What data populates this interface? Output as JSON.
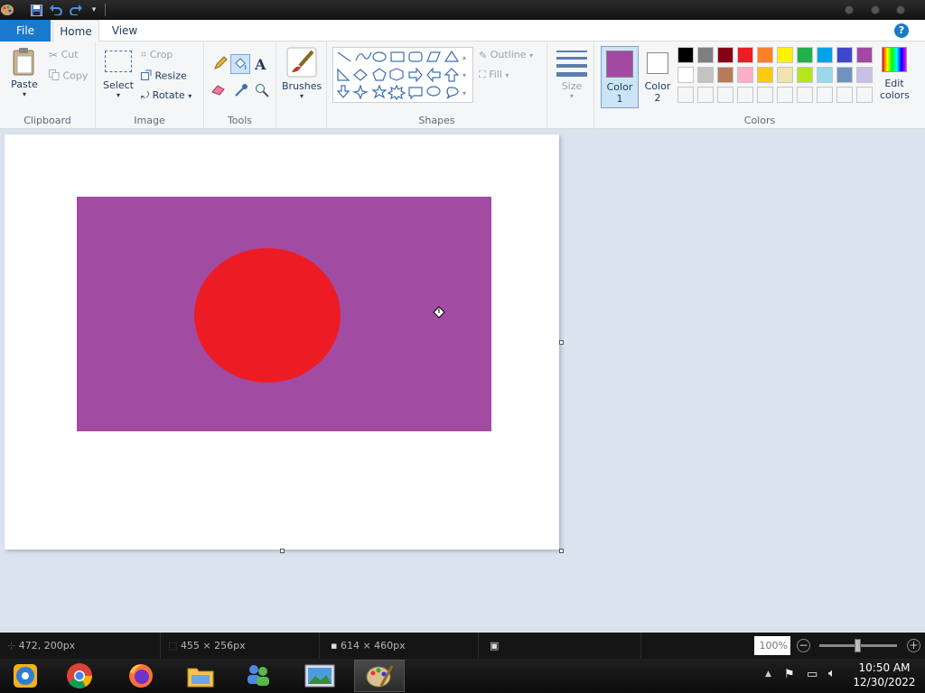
{
  "titlebar": {
    "quick_access": [
      "paint-app-icon",
      "save-icon",
      "undo-icon",
      "redo-icon",
      "customize-icon"
    ]
  },
  "tabs": {
    "file": "File",
    "home": "Home",
    "view": "View"
  },
  "ribbon": {
    "clipboard": {
      "label": "Clipboard",
      "paste": "Paste",
      "cut": "Cut",
      "copy": "Copy"
    },
    "image": {
      "label": "Image",
      "select": "Select",
      "crop": "Crop",
      "resize": "Resize",
      "rotate": "Rotate"
    },
    "tools": {
      "label": "Tools"
    },
    "brushes": {
      "label": "Brushes"
    },
    "shapes": {
      "label": "Shapes",
      "outline": "Outline",
      "fill": "Fill"
    },
    "size": {
      "label": "Size"
    },
    "colors": {
      "label": "Colors",
      "color1_label": "Color",
      "color1_num": "1",
      "color2_label": "Color",
      "color2_num": "2",
      "color1_value": "#a349a4",
      "color2_value": "#ffffff",
      "edit_label": "Edit",
      "edit_label2": "colors",
      "palette_row1": [
        "#000000",
        "#7f7f7f",
        "#880015",
        "#ed1c24",
        "#ff7f27",
        "#fff200",
        "#22b14c",
        "#00a2e8",
        "#3f48cc",
        "#a349a4"
      ],
      "palette_row2": [
        "#ffffff",
        "#c3c3c3",
        "#b97a57",
        "#ffaec9",
        "#ffc90e",
        "#efe4b0",
        "#b5e61d",
        "#99d9ea",
        "#7092be",
        "#c8bfe7"
      ]
    }
  },
  "canvas": {
    "rect_color": "#a24ba3",
    "ellipse_color": "#ed1c24"
  },
  "status": {
    "cursor_pos": "472, 200px",
    "selection_size": "455 × 256px",
    "image_size": "614 × 460px",
    "zoom": "100%",
    "zoom_out": "−",
    "zoom_in": "+"
  },
  "taskbar": {
    "apps": [
      "chrome-canary",
      "chrome",
      "firefox",
      "file-explorer",
      "network-people",
      "photos",
      "paint"
    ],
    "time": "10:50 AM",
    "date": "12/30/2022"
  }
}
